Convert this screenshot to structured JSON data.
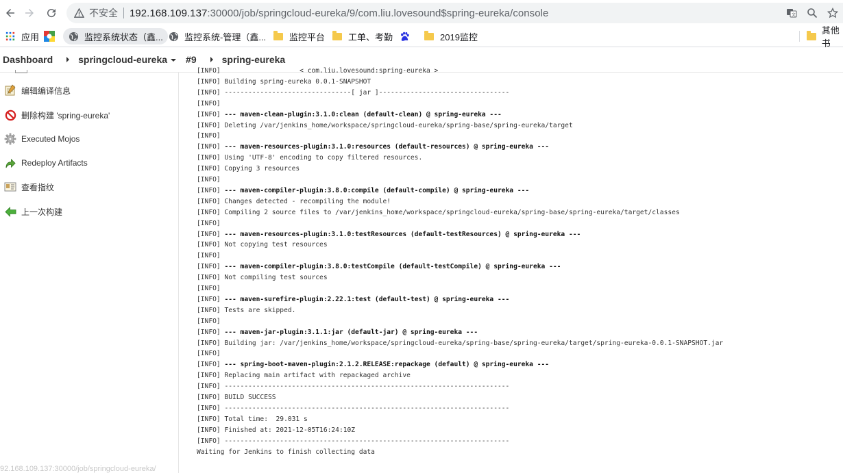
{
  "browser": {
    "security_warning": "不安全",
    "url_host": "192.168.109.137",
    "url_rest": ":30000/job/springcloud-eureka/9/com.liu.lovesound$spring-eureka/console"
  },
  "bookmarks": {
    "items": [
      {
        "label": "应用",
        "icon": "apps-grid-icon"
      },
      {
        "label": "",
        "icon": "colorful-app-icon"
      },
      {
        "label": "监控系统状态（鑫...",
        "icon": "globe-icon"
      },
      {
        "label": "监控系统-管理（鑫...",
        "icon": "globe-icon"
      },
      {
        "label": "监控平台",
        "icon": "folder-icon"
      },
      {
        "label": "工单、考勤",
        "icon": "folder-icon"
      },
      {
        "label": "",
        "icon": "baidu-paw-icon"
      },
      {
        "label": "2019监控",
        "icon": "folder-icon"
      }
    ],
    "more_label": "其他书"
  },
  "breadcrumb": {
    "dashboard": "Dashboard",
    "job": "springcloud-eureka",
    "build": "#9",
    "module": "spring-eureka"
  },
  "sidebar": {
    "items": [
      {
        "label": "编辑编译信息",
        "icon": "notepad-icon"
      },
      {
        "label": "删除构建 'spring-eureka'",
        "icon": "no-entry-icon"
      },
      {
        "label": "Executed Mojos",
        "icon": "gear-icon"
      },
      {
        "label": "Redeploy Artifacts",
        "icon": "redeploy-arrow-icon"
      },
      {
        "label": "查看指纹",
        "icon": "fingerprint-card-icon"
      },
      {
        "label": "上一次构建",
        "icon": "back-arrow-icon"
      }
    ],
    "status_url": "92.168.109.137:30000/job/springcloud-eureka/"
  },
  "console": {
    "lines": [
      {
        "prefix": "[INFO] ",
        "text": "                   < com.liu.lovesound:spring-eureka >",
        "bold": false
      },
      {
        "prefix": "[INFO] ",
        "text": "Building spring-eureka 0.0.1-SNAPSHOT",
        "bold": false
      },
      {
        "prefix": "[INFO] ",
        "text": "--------------------------------[ jar ]---------------------------------",
        "bold": false
      },
      {
        "prefix": "[INFO]",
        "text": "",
        "bold": false
      },
      {
        "prefix": "[INFO] ",
        "text": "--- maven-clean-plugin:3.1.0:clean (default-clean) @ spring-eureka ---",
        "bold": true
      },
      {
        "prefix": "[INFO] ",
        "text": "Deleting /var/jenkins_home/workspace/springcloud-eureka/spring-base/spring-eureka/target",
        "bold": false
      },
      {
        "prefix": "[INFO]",
        "text": "",
        "bold": false
      },
      {
        "prefix": "[INFO] ",
        "text": "--- maven-resources-plugin:3.1.0:resources (default-resources) @ spring-eureka ---",
        "bold": true
      },
      {
        "prefix": "[INFO] ",
        "text": "Using 'UTF-8' encoding to copy filtered resources.",
        "bold": false
      },
      {
        "prefix": "[INFO] ",
        "text": "Copying 3 resources",
        "bold": false
      },
      {
        "prefix": "[INFO]",
        "text": "",
        "bold": false
      },
      {
        "prefix": "[INFO] ",
        "text": "--- maven-compiler-plugin:3.8.0:compile (default-compile) @ spring-eureka ---",
        "bold": true
      },
      {
        "prefix": "[INFO] ",
        "text": "Changes detected - recompiling the module!",
        "bold": false
      },
      {
        "prefix": "[INFO] ",
        "text": "Compiling 2 source files to /var/jenkins_home/workspace/springcloud-eureka/spring-base/spring-eureka/target/classes",
        "bold": false
      },
      {
        "prefix": "[INFO]",
        "text": "",
        "bold": false
      },
      {
        "prefix": "[INFO] ",
        "text": "--- maven-resources-plugin:3.1.0:testResources (default-testResources) @ spring-eureka ---",
        "bold": true
      },
      {
        "prefix": "[INFO] ",
        "text": "Not copying test resources",
        "bold": false
      },
      {
        "prefix": "[INFO]",
        "text": "",
        "bold": false
      },
      {
        "prefix": "[INFO] ",
        "text": "--- maven-compiler-plugin:3.8.0:testCompile (default-testCompile) @ spring-eureka ---",
        "bold": true
      },
      {
        "prefix": "[INFO] ",
        "text": "Not compiling test sources",
        "bold": false
      },
      {
        "prefix": "[INFO]",
        "text": "",
        "bold": false
      },
      {
        "prefix": "[INFO] ",
        "text": "--- maven-surefire-plugin:2.22.1:test (default-test) @ spring-eureka ---",
        "bold": true
      },
      {
        "prefix": "[INFO] ",
        "text": "Tests are skipped.",
        "bold": false
      },
      {
        "prefix": "[INFO]",
        "text": "",
        "bold": false
      },
      {
        "prefix": "[INFO] ",
        "text": "--- maven-jar-plugin:3.1.1:jar (default-jar) @ spring-eureka ---",
        "bold": true
      },
      {
        "prefix": "[INFO] ",
        "text": "Building jar: /var/jenkins_home/workspace/springcloud-eureka/spring-base/spring-eureka/target/spring-eureka-0.0.1-SNAPSHOT.jar",
        "bold": false
      },
      {
        "prefix": "[INFO]",
        "text": "",
        "bold": false
      },
      {
        "prefix": "[INFO] ",
        "text": "--- spring-boot-maven-plugin:2.1.2.RELEASE:repackage (default) @ spring-eureka ---",
        "bold": true
      },
      {
        "prefix": "[INFO] ",
        "text": "Replacing main artifact with repackaged archive",
        "bold": false
      },
      {
        "prefix": "[INFO] ",
        "text": "------------------------------------------------------------------------",
        "bold": false
      },
      {
        "prefix": "[INFO] ",
        "text": "BUILD SUCCESS",
        "bold": false
      },
      {
        "prefix": "[INFO] ",
        "text": "------------------------------------------------------------------------",
        "bold": false
      },
      {
        "prefix": "[INFO] ",
        "text": "Total time:  29.031 s",
        "bold": false
      },
      {
        "prefix": "[INFO] ",
        "text": "Finished at: 2021-12-05T16:24:10Z",
        "bold": false
      },
      {
        "prefix": "[INFO] ",
        "text": "------------------------------------------------------------------------",
        "bold": false
      },
      {
        "prefix": "",
        "text": "Waiting for Jenkins to finish collecting data",
        "bold": false
      }
    ]
  }
}
